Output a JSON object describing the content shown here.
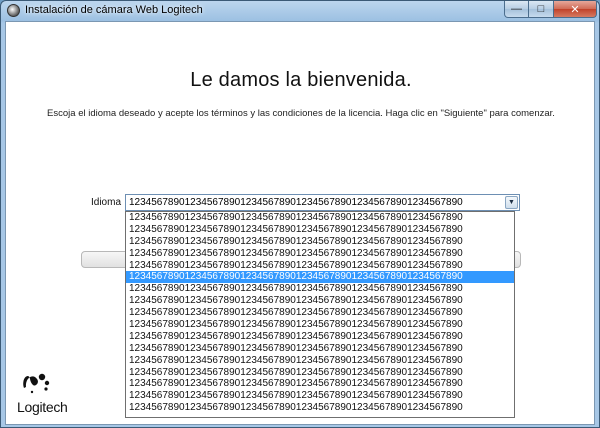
{
  "window": {
    "title": "Instalación de cámara Web Logitech",
    "controls": {
      "minimize": "—",
      "maximize": "□",
      "close": "✕"
    }
  },
  "page": {
    "heading": "Le damos la bienvenida.",
    "instructions": "Escoja el idioma deseado y acepte los términos y las condiciones de la licencia. Haga clic en \"Siguiente\" para comenzar."
  },
  "language": {
    "label": "Idioma",
    "selected_value": "123456789012345678901234567890123456789012345678901234567890",
    "arrow_icon": "combo-arrow-down-icon",
    "options": [
      "123456789012345678901234567890123456789012345678901234567890",
      "123456789012345678901234567890123456789012345678901234567890",
      "123456789012345678901234567890123456789012345678901234567890",
      "123456789012345678901234567890123456789012345678901234567890",
      "123456789012345678901234567890123456789012345678901234567890",
      "123456789012345678901234567890123456789012345678901234567890",
      "123456789012345678901234567890123456789012345678901234567890",
      "123456789012345678901234567890123456789012345678901234567890",
      "123456789012345678901234567890123456789012345678901234567890",
      "123456789012345678901234567890123456789012345678901234567890",
      "123456789012345678901234567890123456789012345678901234567890",
      "123456789012345678901234567890123456789012345678901234567890",
      "123456789012345678901234567890123456789012345678901234567890",
      "123456789012345678901234567890123456789012345678901234567890",
      "123456789012345678901234567890123456789012345678901234567890",
      "123456789012345678901234567890123456789012345678901234567890",
      "123456789012345678901234567890123456789012345678901234567890"
    ],
    "highlighted_index": 5,
    "highlight_color": "#3399ff"
  },
  "brand": {
    "name": "Logitech",
    "logo_icon": "logitech-logo-icon"
  }
}
